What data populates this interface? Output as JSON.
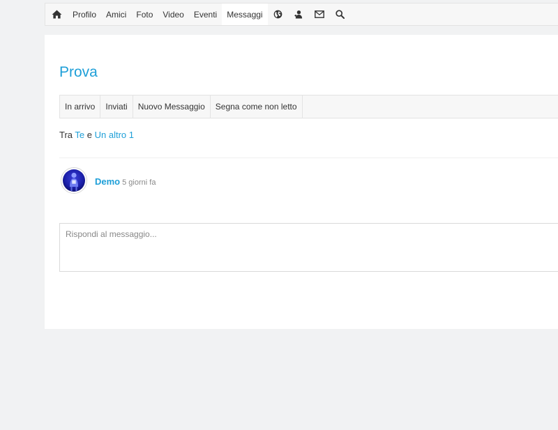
{
  "toolbar": {
    "items": [
      {
        "label": "Profilo"
      },
      {
        "label": "Amici"
      },
      {
        "label": "Foto"
      },
      {
        "label": "Video"
      },
      {
        "label": "Eventi"
      },
      {
        "label": "Messaggi",
        "active": true
      }
    ],
    "icons": [
      "home-icon",
      "globe-icon",
      "user-icon",
      "mail-icon",
      "search-icon"
    ]
  },
  "conversation": {
    "title": "Prova",
    "tabs": [
      {
        "label": "In arrivo"
      },
      {
        "label": "Inviati"
      },
      {
        "label": "Nuovo Messaggio"
      },
      {
        "label": "Segna come non letto"
      }
    ],
    "participants": {
      "prefix": "Tra",
      "first": "Te",
      "conjunction": "e",
      "second": "Un altro 1"
    },
    "message": {
      "author": "Demo",
      "time": "5 giorni fa"
    },
    "reply": {
      "placeholder": "Rispondi al messaggio..."
    }
  },
  "colors": {
    "accent": "#1e9fd8",
    "background": "#f1f2f3",
    "toolbar_bg": "#f7f7f7"
  }
}
